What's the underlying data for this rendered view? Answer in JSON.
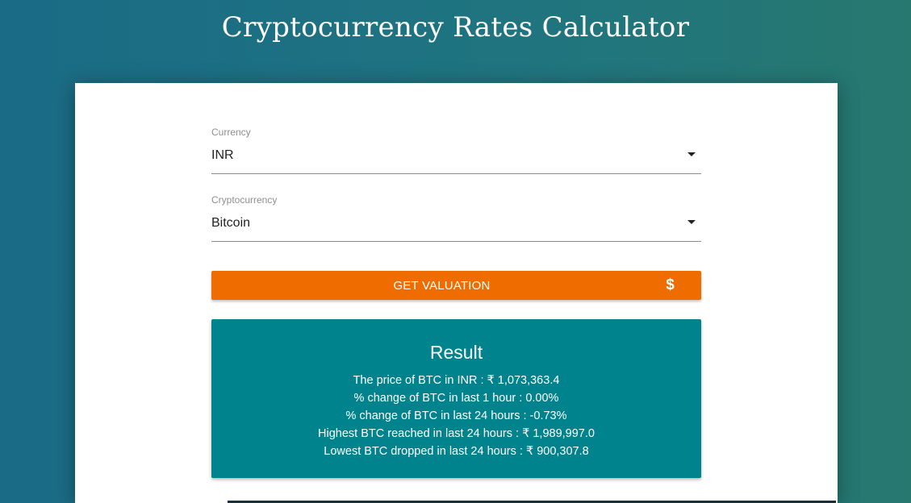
{
  "header": {
    "title": "Cryptocurrency Rates Calculator"
  },
  "form": {
    "currency": {
      "label": "Currency",
      "value": "INR"
    },
    "crypto": {
      "label": "Cryptocurrency",
      "value": "Bitcoin"
    },
    "button": {
      "label": "GET VALUATION",
      "icon": "$"
    }
  },
  "result": {
    "title": "Result",
    "lines": [
      "The price of BTC in INR : ₹ 1,073,363.4",
      "% change of BTC in last 1 hour : 0.00%",
      "% change of BTC in last 24 hours : -0.73%",
      "Highest BTC reached in last 24 hours : ₹ 1,989,997.0",
      "Lowest BTC dropped in last 24 hours : ₹ 900,307.8"
    ]
  },
  "colors": {
    "background_start": "#1a6b86",
    "background_end": "#27786f",
    "button": "#ef6c00",
    "result_box": "#00838c"
  }
}
